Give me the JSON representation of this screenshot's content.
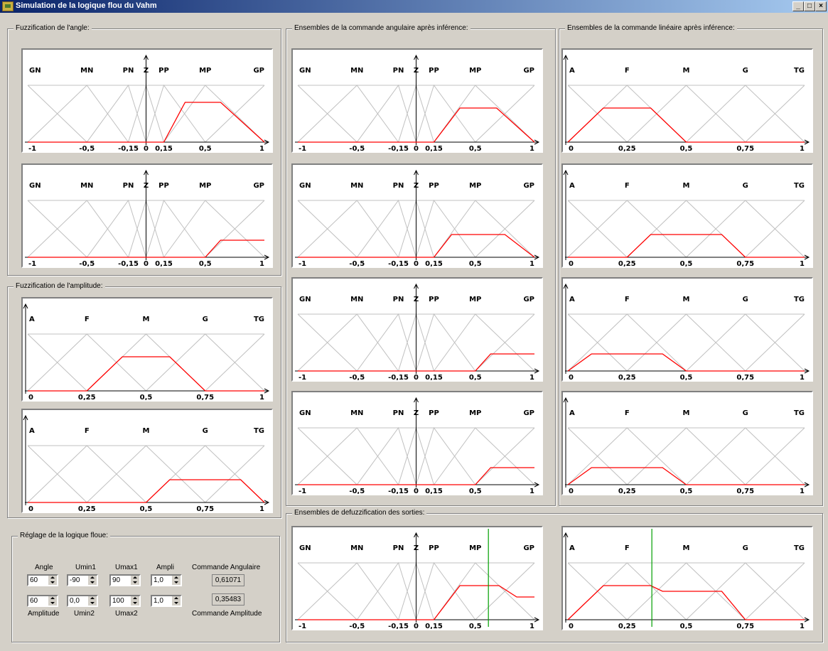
{
  "window": {
    "title": "Simulation de la logique flou du Vahm",
    "min": "_",
    "max": "□",
    "close": "×"
  },
  "groups": {
    "angle": "Fuzzification de l'angle:",
    "amplitude": "Fuzzification de l'amplitude:",
    "commande_ang": "Ensembles de la commande angulaire après inférence:",
    "commande_lin": "Ensembles de la commande linéaire après inférence:",
    "defuzz": "Ensembles de defuzzification des sorties:",
    "reglage": "Réglage de la logique floue:"
  },
  "scales": {
    "angular": {
      "sets": [
        "GN",
        "MN",
        "PN",
        "Z",
        "PP",
        "MP",
        "GP"
      ],
      "ticks": [
        "-1",
        "-0,5",
        "-0,15",
        "0",
        "0,15",
        "0,5",
        "1"
      ]
    },
    "linear": {
      "sets": [
        "A",
        "F",
        "M",
        "G",
        "TG"
      ],
      "ticks": [
        "0",
        "0,25",
        "0,5",
        "0,75",
        "1"
      ]
    }
  },
  "chart_data": [
    {
      "type": "line",
      "panel": "angle-1",
      "domain": "angular",
      "membership": [
        [
          -1,
          0
        ],
        [
          0.15,
          0
        ],
        [
          0.33,
          0.7
        ],
        [
          0.63,
          0.7
        ],
        [
          1,
          0
        ]
      ]
    },
    {
      "type": "line",
      "panel": "angle-2",
      "domain": "angular",
      "membership": [
        [
          -1,
          0
        ],
        [
          0.5,
          0
        ],
        [
          0.63,
          0.3
        ],
        [
          1,
          0.3
        ]
      ]
    },
    {
      "type": "line",
      "panel": "amplitude-1",
      "domain": "linear",
      "membership": [
        [
          0,
          0
        ],
        [
          0.25,
          0
        ],
        [
          0.4,
          0.6
        ],
        [
          0.6,
          0.6
        ],
        [
          0.75,
          0
        ],
        [
          1,
          0
        ]
      ]
    },
    {
      "type": "line",
      "panel": "amplitude-2",
      "domain": "linear",
      "membership": [
        [
          0,
          0
        ],
        [
          0.5,
          0
        ],
        [
          0.6,
          0.4
        ],
        [
          0.9,
          0.4
        ],
        [
          1,
          0
        ]
      ]
    },
    {
      "type": "line",
      "panel": "angulaire-1",
      "domain": "angular",
      "membership": [
        [
          -1,
          0
        ],
        [
          0.15,
          0
        ],
        [
          0.37,
          0.6
        ],
        [
          0.68,
          0.6
        ],
        [
          1,
          0
        ]
      ]
    },
    {
      "type": "line",
      "panel": "angulaire-2",
      "domain": "angular",
      "membership": [
        [
          -1,
          0
        ],
        [
          0.15,
          0
        ],
        [
          0.3,
          0.4
        ],
        [
          0.75,
          0.4
        ],
        [
          1,
          0
        ]
      ]
    },
    {
      "type": "line",
      "panel": "angulaire-3",
      "domain": "angular",
      "membership": [
        [
          -1,
          0
        ],
        [
          0.5,
          0
        ],
        [
          0.63,
          0.3
        ],
        [
          1,
          0.3
        ]
      ]
    },
    {
      "type": "line",
      "panel": "angulaire-4",
      "domain": "angular",
      "membership": [
        [
          -1,
          0
        ],
        [
          0.5,
          0
        ],
        [
          0.63,
          0.3
        ],
        [
          1,
          0.3
        ]
      ]
    },
    {
      "type": "line",
      "panel": "lineaire-1",
      "domain": "linear",
      "membership": [
        [
          0,
          0
        ],
        [
          0.15,
          0.6
        ],
        [
          0.35,
          0.6
        ],
        [
          0.5,
          0
        ],
        [
          1,
          0
        ]
      ]
    },
    {
      "type": "line",
      "panel": "lineaire-2",
      "domain": "linear",
      "membership": [
        [
          0,
          0
        ],
        [
          0.25,
          0
        ],
        [
          0.35,
          0.4
        ],
        [
          0.65,
          0.4
        ],
        [
          0.75,
          0
        ],
        [
          1,
          0
        ]
      ]
    },
    {
      "type": "line",
      "panel": "lineaire-3",
      "domain": "linear",
      "membership": [
        [
          0,
          0
        ],
        [
          0.1,
          0.3
        ],
        [
          0.4,
          0.3
        ],
        [
          0.5,
          0
        ],
        [
          1,
          0
        ]
      ]
    },
    {
      "type": "line",
      "panel": "lineaire-4",
      "domain": "linear",
      "membership": [
        [
          0,
          0
        ],
        [
          0.1,
          0.3
        ],
        [
          0.4,
          0.3
        ],
        [
          0.5,
          0
        ],
        [
          1,
          0
        ]
      ]
    },
    {
      "type": "line",
      "panel": "defuzz-angulaire",
      "domain": "angular",
      "membership": [
        [
          -1,
          0
        ],
        [
          0.15,
          0
        ],
        [
          0.37,
          0.6
        ],
        [
          0.7,
          0.6
        ],
        [
          0.85,
          0.4
        ],
        [
          1,
          0.4
        ]
      ],
      "marker": 0.61071
    },
    {
      "type": "line",
      "panel": "defuzz-lineaire",
      "domain": "linear",
      "membership": [
        [
          0,
          0
        ],
        [
          0.15,
          0.6
        ],
        [
          0.35,
          0.6
        ],
        [
          0.4,
          0.5
        ],
        [
          0.65,
          0.5
        ],
        [
          0.75,
          0
        ],
        [
          1,
          0
        ]
      ],
      "marker": 0.35483
    }
  ],
  "reglage": {
    "headers": {
      "angle": "Angle",
      "umin1": "Umin1",
      "umax1": "Umax1",
      "ampli": "Ampli",
      "cmd_ang": "Commande Angulaire"
    },
    "footers": {
      "amplitude": "Amplitude",
      "umin2": "Umin2",
      "umax2": "Umax2",
      "cmd_amp": "Commande Amplitude"
    },
    "row1": {
      "angle": "60",
      "umin1": "-90",
      "umax1": "90",
      "ampli": "1,0",
      "output": "0,61071"
    },
    "row2": {
      "amplitude": "60",
      "umin2": "0,0",
      "umax2": "100",
      "ampli": "1,0",
      "output": "0,35483"
    }
  },
  "colors": {
    "membership": "#ff0000",
    "marker": "#00a000",
    "grid": "#c0c0c0",
    "axis": "#000000"
  }
}
